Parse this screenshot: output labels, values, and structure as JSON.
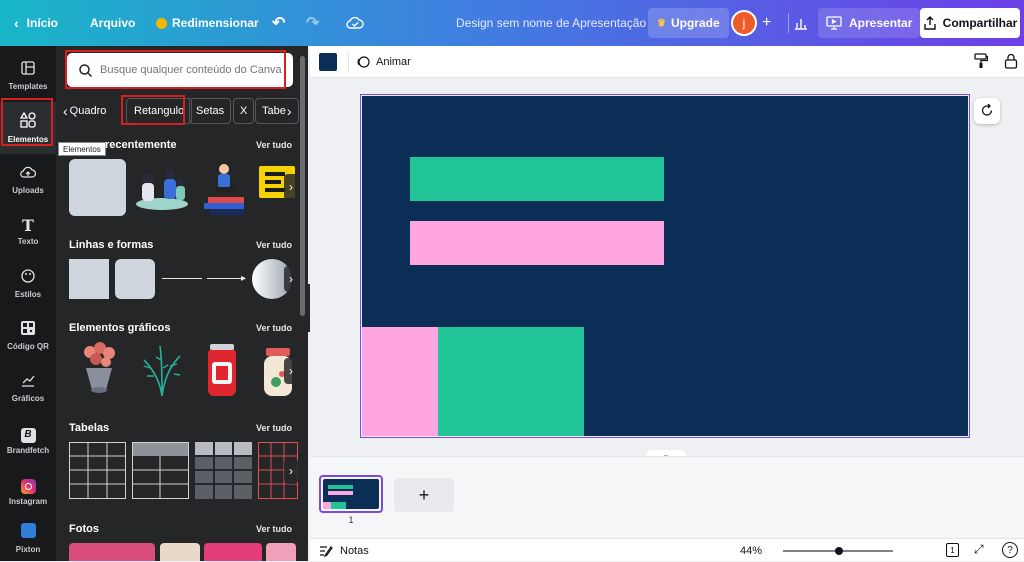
{
  "topbar": {
    "home": "Início",
    "file": "Arquivo",
    "resize": "Redimensionar",
    "design_title": "Design sem nome de Apresentação",
    "upgrade": "Upgrade",
    "avatar_letter": "j",
    "add": "+",
    "present": "Apresentar",
    "share": "Compartilhar"
  },
  "rail": {
    "items": [
      {
        "label": "Templates",
        "icon": "templates-icon"
      },
      {
        "label": "Elementos",
        "icon": "elements-icon"
      },
      {
        "label": "Uploads",
        "icon": "upload-icon"
      },
      {
        "label": "Texto",
        "icon": "text-icon"
      },
      {
        "label": "Estilos",
        "icon": "styles-icon"
      },
      {
        "label": "Código QR",
        "icon": "qr-icon"
      },
      {
        "label": "Gráficos",
        "icon": "chart-icon"
      },
      {
        "label": "Brandfetch",
        "icon": "brandfetch-icon"
      },
      {
        "label": "Instagram",
        "icon": "instagram-icon"
      },
      {
        "label": "Pixton",
        "icon": "pixton-icon"
      }
    ],
    "tooltip": "Elementos"
  },
  "panel": {
    "search_placeholder": "Busque qualquer conteúdo do Canva",
    "chips": [
      "Quadro",
      "Retangulo",
      "Setas",
      "X",
      "Tabe"
    ],
    "sections": {
      "recent": "recentemente",
      "lines": "Linhas e formas",
      "graphics": "Elementos gráficos",
      "tables": "Tabelas",
      "photos": "Fotos"
    },
    "see_all": "Ver tudo"
  },
  "toolbar": {
    "animate": "Animar",
    "color_swatch": "#0b2e57"
  },
  "canvas": {
    "bg": "#0b2e57",
    "green": "#21c497",
    "pink": "#ffa6e0"
  },
  "pages": {
    "page_number": "1",
    "add_page": "+"
  },
  "footer": {
    "notes": "Notas",
    "zoom": "44%",
    "zoom_level": 0.44,
    "page_indicator": "1",
    "help": "?"
  }
}
